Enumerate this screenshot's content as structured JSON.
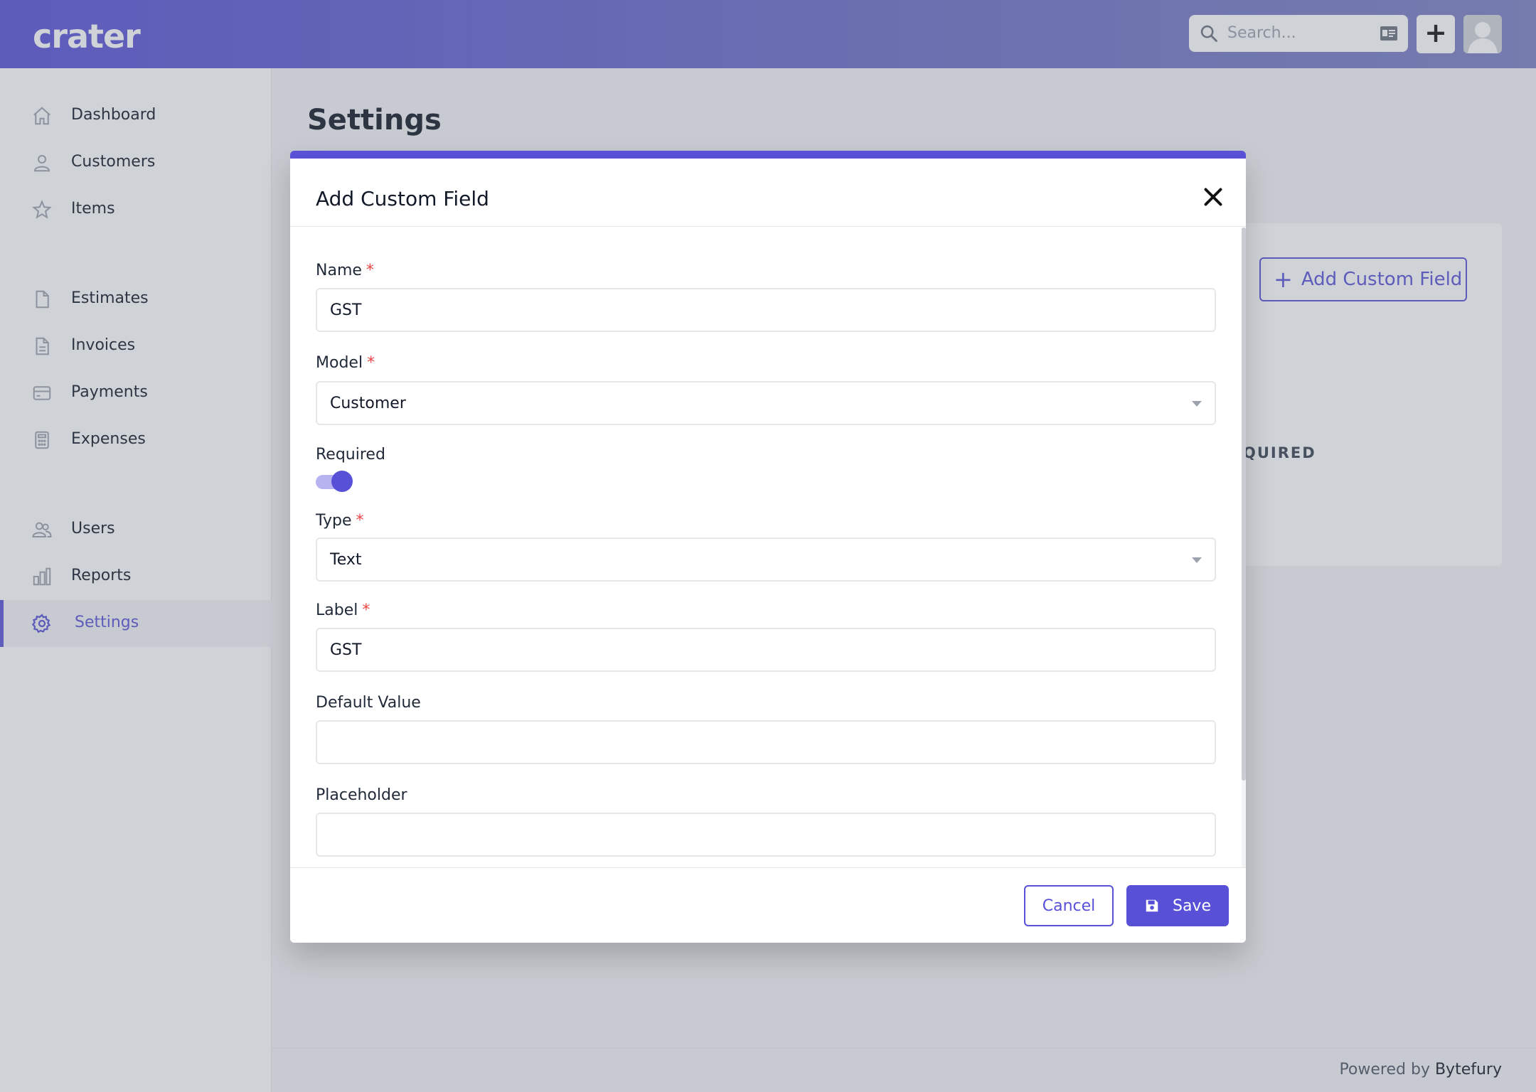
{
  "app": {
    "logo": "crater"
  },
  "header": {
    "search_placeholder": "Search...",
    "add_label": "+"
  },
  "sidebar": {
    "items": [
      {
        "label": "Dashboard",
        "icon": "home-icon"
      },
      {
        "label": "Customers",
        "icon": "user-icon"
      },
      {
        "label": "Items",
        "icon": "star-icon"
      },
      {
        "label": "Estimates",
        "icon": "document-icon"
      },
      {
        "label": "Invoices",
        "icon": "document-text-icon"
      },
      {
        "label": "Payments",
        "icon": "credit-card-icon"
      },
      {
        "label": "Expenses",
        "icon": "calculator-icon"
      },
      {
        "label": "Users",
        "icon": "users-icon"
      },
      {
        "label": "Reports",
        "icon": "chart-bar-icon"
      },
      {
        "label": "Settings",
        "icon": "cog-icon"
      }
    ],
    "active": "Settings"
  },
  "main": {
    "title": "Settings",
    "add_custom_field_label": "Add Custom Field",
    "column_partial": "QUIRED"
  },
  "modal": {
    "title": "Add Custom Field",
    "fields": {
      "name": {
        "label": "Name",
        "required_mark": "*",
        "value": "GST"
      },
      "model": {
        "label": "Model",
        "required_mark": "*",
        "value": "Customer"
      },
      "required": {
        "label": "Required",
        "on": true
      },
      "type": {
        "label": "Type",
        "required_mark": "*",
        "value": "Text"
      },
      "label": {
        "label": "Label",
        "required_mark": "*",
        "value": "GST"
      },
      "default_value": {
        "label": "Default Value",
        "value": ""
      },
      "placeholder": {
        "label": "Placeholder",
        "value": ""
      }
    },
    "cancel_label": "Cancel",
    "save_label": "Save"
  },
  "footer": {
    "prefix": "Powered by",
    "brand": "Bytefury"
  },
  "colors": {
    "primary": "#5851d8",
    "danger": "#ef4444"
  }
}
